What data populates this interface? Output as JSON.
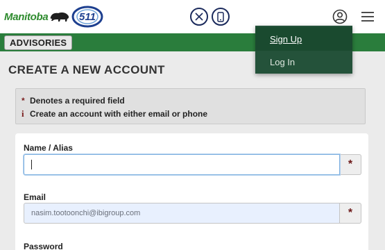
{
  "header": {
    "logo_text": "Manitoba",
    "badge_text": "511",
    "icons": {
      "x_icon": "x-twitter-icon",
      "phone_icon": "phone-icon",
      "user_icon": "user-account-icon",
      "menu_icon": "hamburger-menu-icon"
    }
  },
  "nav": {
    "advisories_label": "ADVISORIES"
  },
  "dropdown": {
    "items": [
      {
        "label": "Sign Up",
        "active": true
      },
      {
        "label": "Log In",
        "active": false
      }
    ]
  },
  "page": {
    "title": "CREATE A NEW ACCOUNT"
  },
  "info": {
    "required_note": "Denotes a required field",
    "required_symbol": "*",
    "account_note": "Create an account with either email or phone",
    "info_symbol": "i"
  },
  "form": {
    "name": {
      "label": "Name / Alias",
      "value": "",
      "required_symbol": "*"
    },
    "email": {
      "label": "Email",
      "value": "nasim.tootoonchi@ibigroup.com",
      "required_symbol": "*"
    },
    "password": {
      "label": "Password"
    }
  },
  "colors": {
    "brand_green": "#2a7d3c",
    "dropdown_bg": "#24523a",
    "required_red": "#6b1616",
    "icon_navy": "#1b2a5c"
  }
}
